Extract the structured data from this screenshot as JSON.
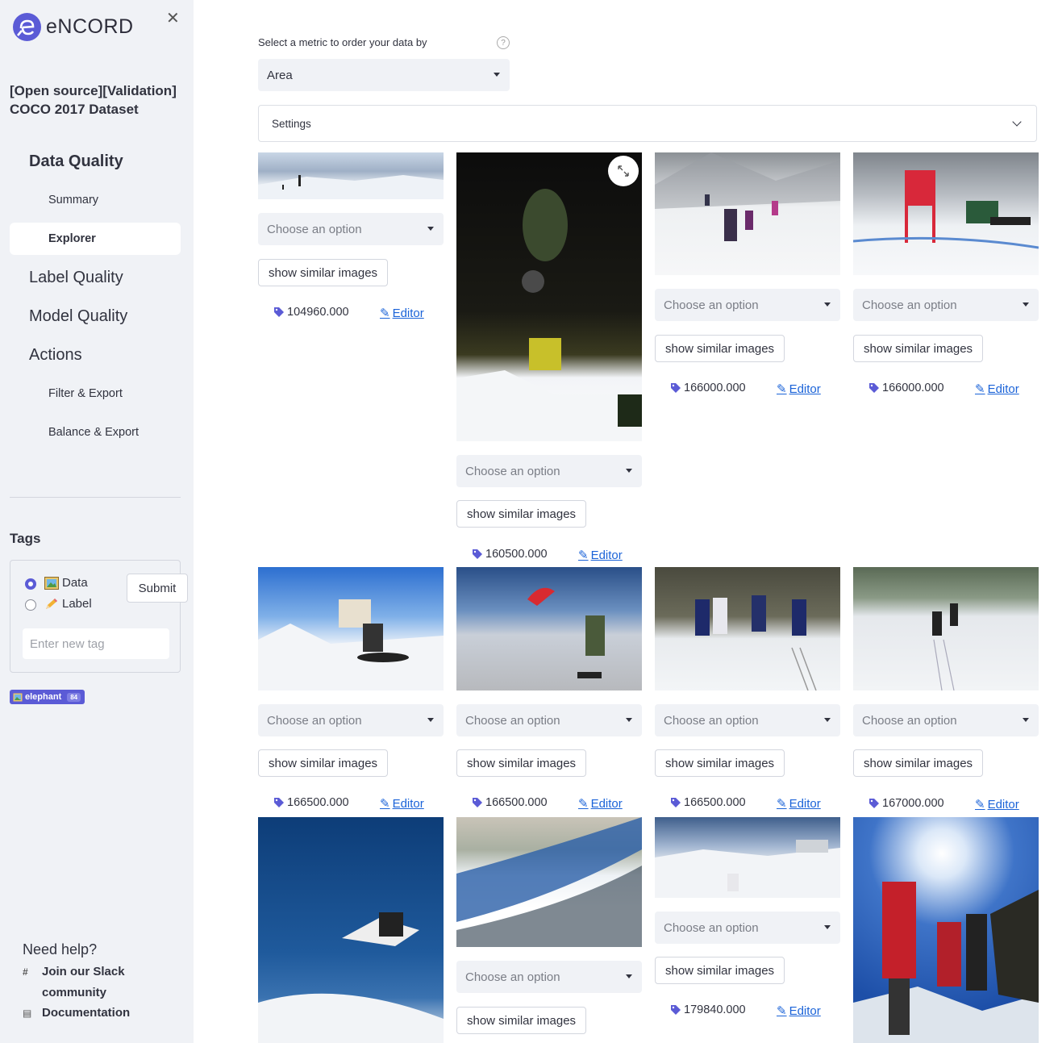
{
  "app": {
    "logo_text": "eNCORD",
    "close_symbol": "✕",
    "dataset_title": "[Open source][Validation] COCO 2017 Dataset"
  },
  "nav": {
    "data_quality": "Data Quality",
    "summary": "Summary",
    "explorer": "Explorer",
    "label_quality": "Label Quality",
    "model_quality": "Model Quality",
    "actions": "Actions",
    "filter_export": "Filter & Export",
    "balance_export": "Balance & Export"
  },
  "tags": {
    "title": "Tags",
    "option_data": "Data",
    "option_label": "Label",
    "selected": "Data",
    "submit": "Submit",
    "input_placeholder": "Enter new tag",
    "chip_name": "elephant",
    "chip_count": "84"
  },
  "help": {
    "title": "Need help?",
    "slack_line1": "Join our Slack",
    "slack_line2": "community",
    "docs": "Documentation"
  },
  "main": {
    "metric_label": "Select a metric to order your data by",
    "metric_value": "Area",
    "settings_label": "Settings",
    "choose_placeholder": "Choose an option",
    "similar_button": "show similar images",
    "editor_label": "Editor"
  },
  "cards": [
    {
      "value": "104960.000"
    },
    {
      "value": "160500.000"
    },
    {
      "value": "166000.000"
    },
    {
      "value": "166000.000"
    },
    {
      "value": "166500.000"
    },
    {
      "value": "166500.000"
    },
    {
      "value": "166500.000"
    },
    {
      "value": "167000.000"
    },
    {
      "value": "179840.000"
    }
  ],
  "colors": {
    "accent": "#5b5bd6",
    "link": "#1b63d8",
    "sidebar_bg": "#f0f2f6"
  }
}
